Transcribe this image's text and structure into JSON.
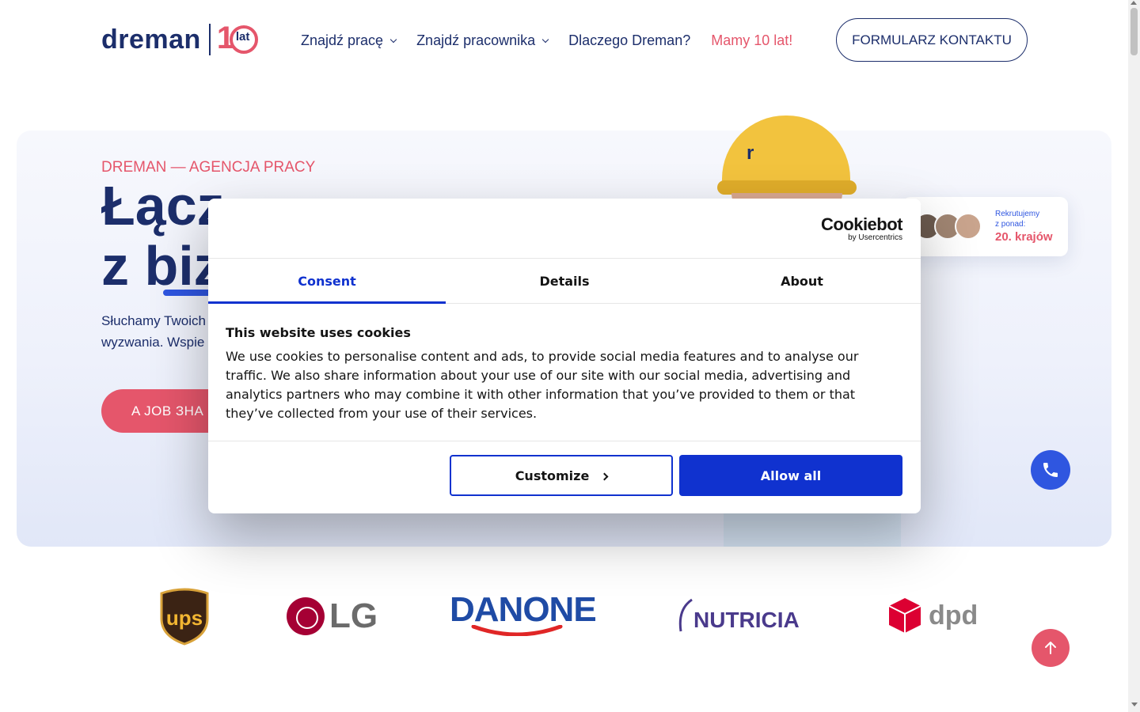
{
  "header": {
    "logo_text": "dreman",
    "logo_badge_number": "1",
    "logo_badge_text": "lat",
    "nav": [
      {
        "label": "Znajdź pracę"
      },
      {
        "label": "Znajdź pracownika"
      },
      {
        "label": "Dlaczego Dreman?"
      },
      {
        "label": "Mamy 10 lat!"
      }
    ],
    "contact_button": "FORMULARZ KONTAKTU"
  },
  "hero": {
    "eyebrow": "DREMAN — AGENCJA PRACY",
    "headline_line1": "Łącz",
    "headline_line2": "z biz",
    "subtext_line1": "Słuchamy Twoich",
    "subtext_line2": "wyzwania. Wspie",
    "cta_button": "A JOB  ЗНА",
    "badge": {
      "line1": "Rekrutujemy",
      "line2": "z ponad:",
      "highlight": "20. krajów"
    },
    "helmet_mark": "r"
  },
  "client_logos": [
    "ups",
    "LG",
    "DANONE",
    "NUTRICIA",
    "dpd"
  ],
  "cookie_dialog": {
    "brand": "Cookiebot",
    "brand_sub": "by Usercentrics",
    "tabs": [
      {
        "label": "Consent",
        "active": true
      },
      {
        "label": "Details",
        "active": false
      },
      {
        "label": "About",
        "active": false
      }
    ],
    "title": "This website uses cookies",
    "body": "We use cookies to personalise content and ads, to provide social media features and to analyse our traffic. We also share information about your use of our site with our social media, advertising and analytics partners who may combine it with other information that you’ve provided to them or that they’ve collected from your use of their services.",
    "customize_button": "Customize",
    "allow_button": "Allow all"
  },
  "colors": {
    "brand_navy": "#1c2e6b",
    "brand_pink": "#e5566b",
    "accent_blue": "#2f56e0",
    "cookiebot_blue": "#1032cf"
  },
  "icons": [
    "chevron-down-icon",
    "phone-icon",
    "arrow-up-icon",
    "chevron-right-icon"
  ]
}
